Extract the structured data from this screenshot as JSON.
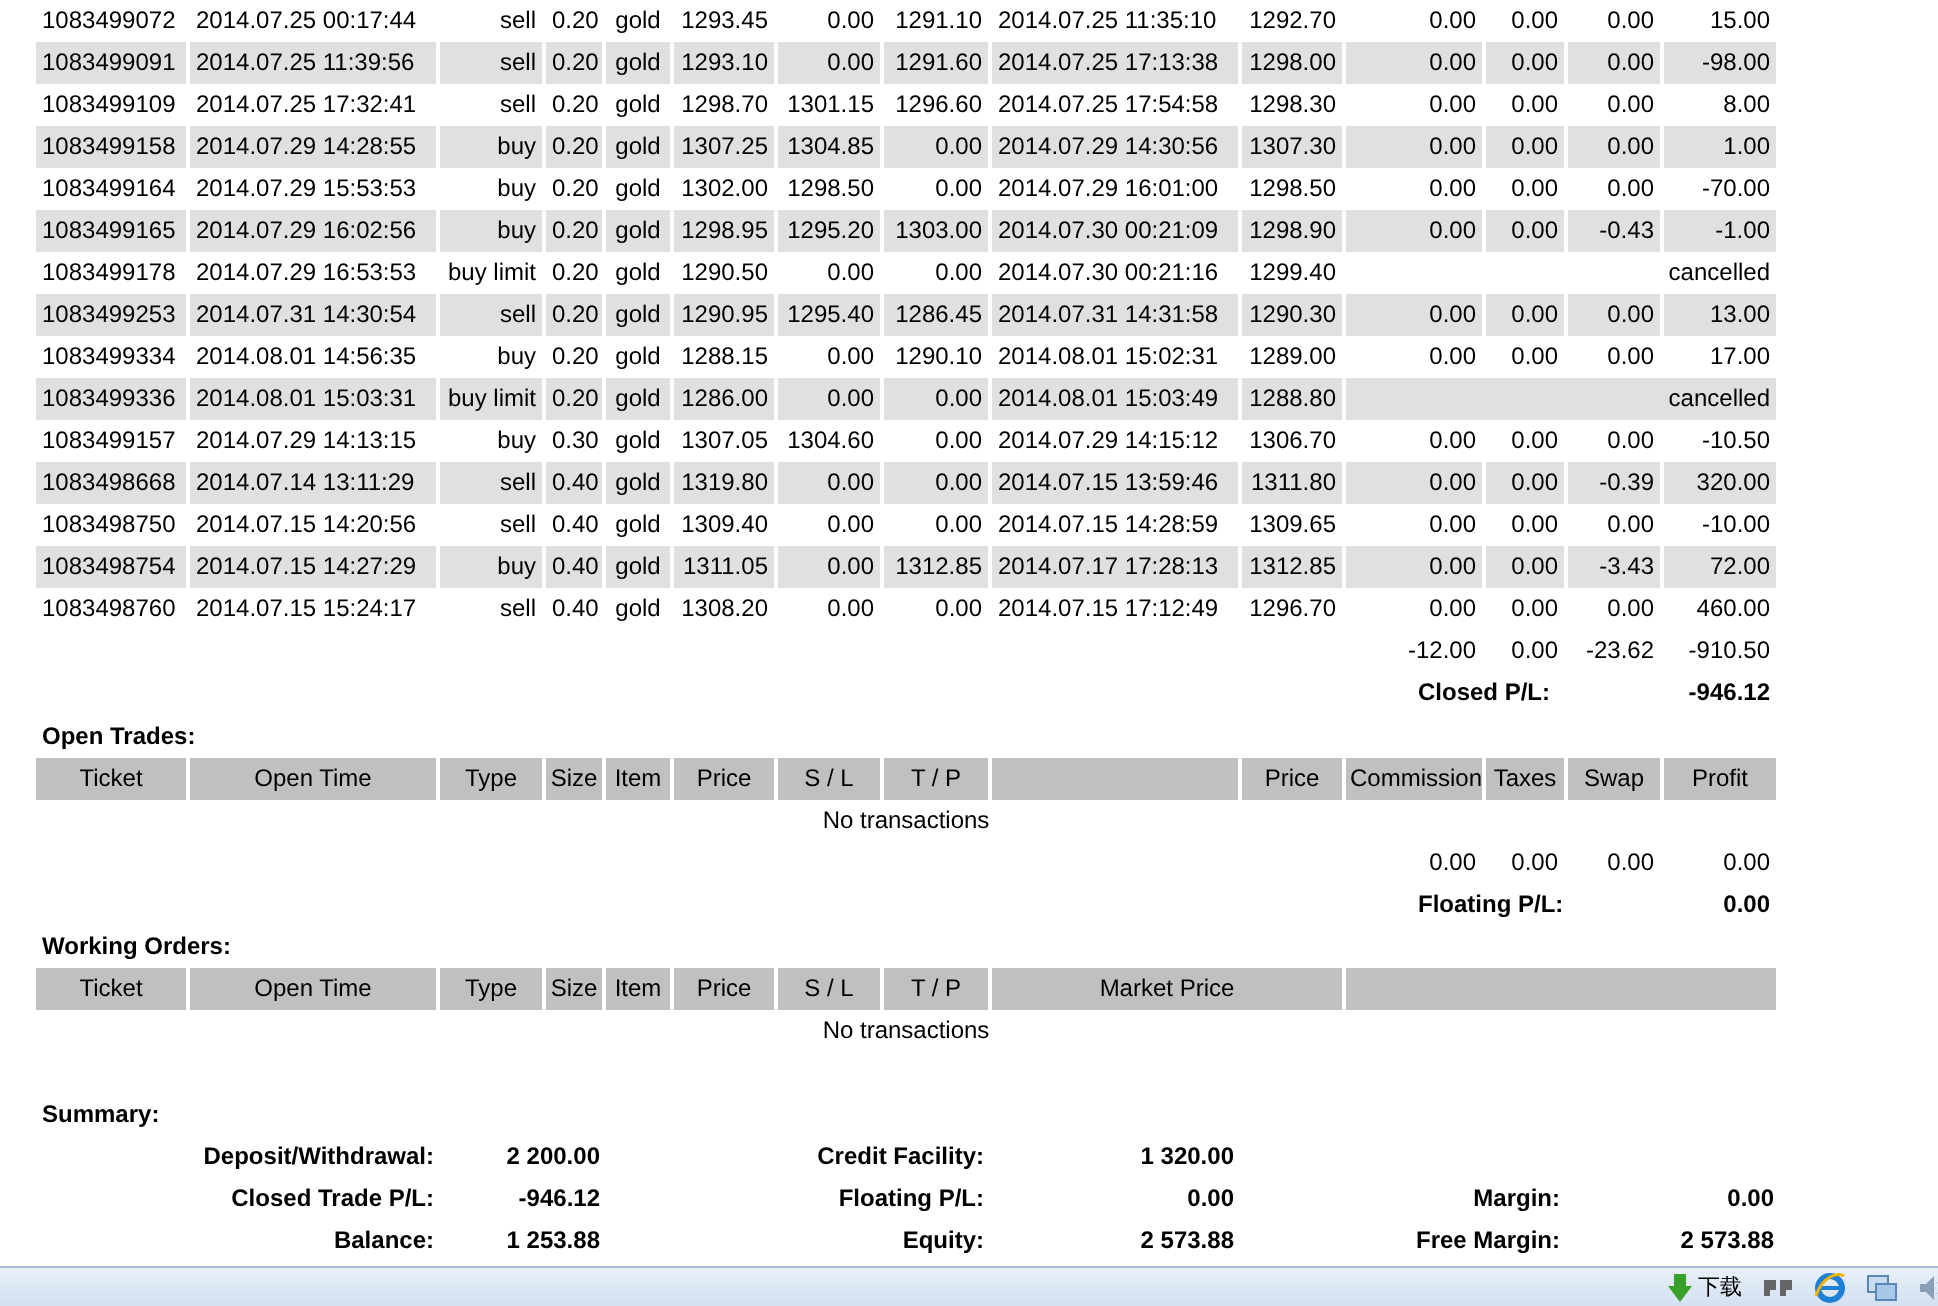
{
  "closed_transactions": {
    "rows": [
      {
        "kind": "closed",
        "ticket": "1083499072",
        "open_time": "2014.07.25 00:17:44",
        "type": "sell",
        "size": "0.20",
        "item": "gold",
        "price": "1293.45",
        "sl": "0.00",
        "tp": "1291.10",
        "close_time": "2014.07.25 11:35:10",
        "close_price": "1292.70",
        "commission": "0.00",
        "taxes": "0.00",
        "swap": "0.00",
        "profit": "15.00"
      },
      {
        "kind": "closed",
        "ticket": "1083499091",
        "open_time": "2014.07.25 11:39:56",
        "type": "sell",
        "size": "0.20",
        "item": "gold",
        "price": "1293.10",
        "sl": "0.00",
        "tp": "1291.60",
        "close_time": "2014.07.25 17:13:38",
        "close_price": "1298.00",
        "commission": "0.00",
        "taxes": "0.00",
        "swap": "0.00",
        "profit": "-98.00"
      },
      {
        "kind": "closed",
        "ticket": "1083499109",
        "open_time": "2014.07.25 17:32:41",
        "type": "sell",
        "size": "0.20",
        "item": "gold",
        "price": "1298.70",
        "sl": "1301.15",
        "tp": "1296.60",
        "close_time": "2014.07.25 17:54:58",
        "close_price": "1298.30",
        "commission": "0.00",
        "taxes": "0.00",
        "swap": "0.00",
        "profit": "8.00"
      },
      {
        "kind": "closed",
        "ticket": "1083499158",
        "open_time": "2014.07.29 14:28:55",
        "type": "buy",
        "size": "0.20",
        "item": "gold",
        "price": "1307.25",
        "sl": "1304.85",
        "tp": "0.00",
        "close_time": "2014.07.29 14:30:56",
        "close_price": "1307.30",
        "commission": "0.00",
        "taxes": "0.00",
        "swap": "0.00",
        "profit": "1.00"
      },
      {
        "kind": "closed",
        "ticket": "1083499164",
        "open_time": "2014.07.29 15:53:53",
        "type": "buy",
        "size": "0.20",
        "item": "gold",
        "price": "1302.00",
        "sl": "1298.50",
        "tp": "0.00",
        "close_time": "2014.07.29 16:01:00",
        "close_price": "1298.50",
        "commission": "0.00",
        "taxes": "0.00",
        "swap": "0.00",
        "profit": "-70.00"
      },
      {
        "kind": "closed",
        "ticket": "1083499165",
        "open_time": "2014.07.29 16:02:56",
        "type": "buy",
        "size": "0.20",
        "item": "gold",
        "price": "1298.95",
        "sl": "1295.20",
        "tp": "1303.00",
        "close_time": "2014.07.30 00:21:09",
        "close_price": "1298.90",
        "commission": "0.00",
        "taxes": "0.00",
        "swap": "-0.43",
        "profit": "-1.00"
      },
      {
        "kind": "cancelled",
        "ticket": "1083499178",
        "open_time": "2014.07.29 16:53:53",
        "type": "buy limit",
        "size": "0.20",
        "item": "gold",
        "price": "1290.50",
        "sl": "0.00",
        "tp": "0.00",
        "close_time": "2014.07.30 00:21:16",
        "close_price": "1299.40",
        "profit": "cancelled"
      },
      {
        "kind": "closed",
        "ticket": "1083499253",
        "open_time": "2014.07.31 14:30:54",
        "type": "sell",
        "size": "0.20",
        "item": "gold",
        "price": "1290.95",
        "sl": "1295.40",
        "tp": "1286.45",
        "close_time": "2014.07.31 14:31:58",
        "close_price": "1290.30",
        "commission": "0.00",
        "taxes": "0.00",
        "swap": "0.00",
        "profit": "13.00"
      },
      {
        "kind": "closed",
        "ticket": "1083499334",
        "open_time": "2014.08.01 14:56:35",
        "type": "buy",
        "size": "0.20",
        "item": "gold",
        "price": "1288.15",
        "sl": "0.00",
        "tp": "1290.10",
        "close_time": "2014.08.01 15:02:31",
        "close_price": "1289.00",
        "commission": "0.00",
        "taxes": "0.00",
        "swap": "0.00",
        "profit": "17.00"
      },
      {
        "kind": "cancelled",
        "ticket": "1083499336",
        "open_time": "2014.08.01 15:03:31",
        "type": "buy limit",
        "size": "0.20",
        "item": "gold",
        "price": "1286.00",
        "sl": "0.00",
        "tp": "0.00",
        "close_time": "2014.08.01 15:03:49",
        "close_price": "1288.80",
        "profit": "cancelled"
      },
      {
        "kind": "closed",
        "ticket": "1083499157",
        "open_time": "2014.07.29 14:13:15",
        "type": "buy",
        "size": "0.30",
        "item": "gold",
        "price": "1307.05",
        "sl": "1304.60",
        "tp": "0.00",
        "close_time": "2014.07.29 14:15:12",
        "close_price": "1306.70",
        "commission": "0.00",
        "taxes": "0.00",
        "swap": "0.00",
        "profit": "-10.50"
      },
      {
        "kind": "closed",
        "ticket": "1083498668",
        "open_time": "2014.07.14 13:11:29",
        "type": "sell",
        "size": "0.40",
        "item": "gold",
        "price": "1319.80",
        "sl": "0.00",
        "tp": "0.00",
        "close_time": "2014.07.15 13:59:46",
        "close_price": "1311.80",
        "commission": "0.00",
        "taxes": "0.00",
        "swap": "-0.39",
        "profit": "320.00"
      },
      {
        "kind": "closed",
        "ticket": "1083498750",
        "open_time": "2014.07.15 14:20:56",
        "type": "sell",
        "size": "0.40",
        "item": "gold",
        "price": "1309.40",
        "sl": "0.00",
        "tp": "0.00",
        "close_time": "2014.07.15 14:28:59",
        "close_price": "1309.65",
        "commission": "0.00",
        "taxes": "0.00",
        "swap": "0.00",
        "profit": "-10.00"
      },
      {
        "kind": "closed",
        "ticket": "1083498754",
        "open_time": "2014.07.15 14:27:29",
        "type": "buy",
        "size": "0.40",
        "item": "gold",
        "price": "1311.05",
        "sl": "0.00",
        "tp": "1312.85",
        "close_time": "2014.07.17 17:28:13",
        "close_price": "1312.85",
        "commission": "0.00",
        "taxes": "0.00",
        "swap": "-3.43",
        "profit": "72.00"
      },
      {
        "kind": "closed",
        "ticket": "1083498760",
        "open_time": "2014.07.15 15:24:17",
        "type": "sell",
        "size": "0.40",
        "item": "gold",
        "price": "1308.20",
        "sl": "0.00",
        "tp": "0.00",
        "close_time": "2014.07.15 17:12:49",
        "close_price": "1296.70",
        "commission": "0.00",
        "taxes": "0.00",
        "swap": "0.00",
        "profit": "460.00"
      }
    ],
    "totals": {
      "commission": "-12.00",
      "taxes": "0.00",
      "swap": "-23.62",
      "profit": "-910.50"
    },
    "result": {
      "label": "Closed P/L:",
      "value": "-946.12"
    }
  },
  "open_trades": {
    "title": "Open Trades:",
    "columns_left": [
      "Ticket",
      "Open Time",
      "Type",
      "Size",
      "Item",
      "Price",
      "S / L",
      "T / P"
    ],
    "columns_right": [
      "Price",
      "Commission",
      "Taxes",
      "Swap",
      "Profit"
    ],
    "empty_text": "No transactions",
    "totals": {
      "commission": "0.00",
      "taxes": "0.00",
      "swap": "0.00",
      "profit": "0.00"
    },
    "result": {
      "label": "Floating P/L:",
      "value": "0.00"
    }
  },
  "working_orders": {
    "title": "Working Orders:",
    "columns": [
      "Ticket",
      "Open Time",
      "Type",
      "Size",
      "Item",
      "Price",
      "S / L",
      "T / P",
      "Market Price"
    ],
    "empty_text": "No transactions"
  },
  "summary": {
    "title": "Summary:",
    "columns": [
      [
        {
          "label": "Deposit/Withdrawal:",
          "value": "2 200.00"
        },
        {
          "label": "Closed Trade P/L:",
          "value": "-946.12"
        },
        {
          "label": "Balance:",
          "value": "1 253.88"
        }
      ],
      [
        {
          "label": "Credit Facility:",
          "value": "1 320.00"
        },
        {
          "label": "Floating P/L:",
          "value": "0.00"
        },
        {
          "label": "Equity:",
          "value": "2 573.88"
        }
      ],
      [
        {
          "label": "Margin:",
          "value": "0.00"
        },
        {
          "label": "Free Margin:",
          "value": "2 573.88"
        }
      ]
    ]
  },
  "status_bar": {
    "download_label": "下载"
  }
}
